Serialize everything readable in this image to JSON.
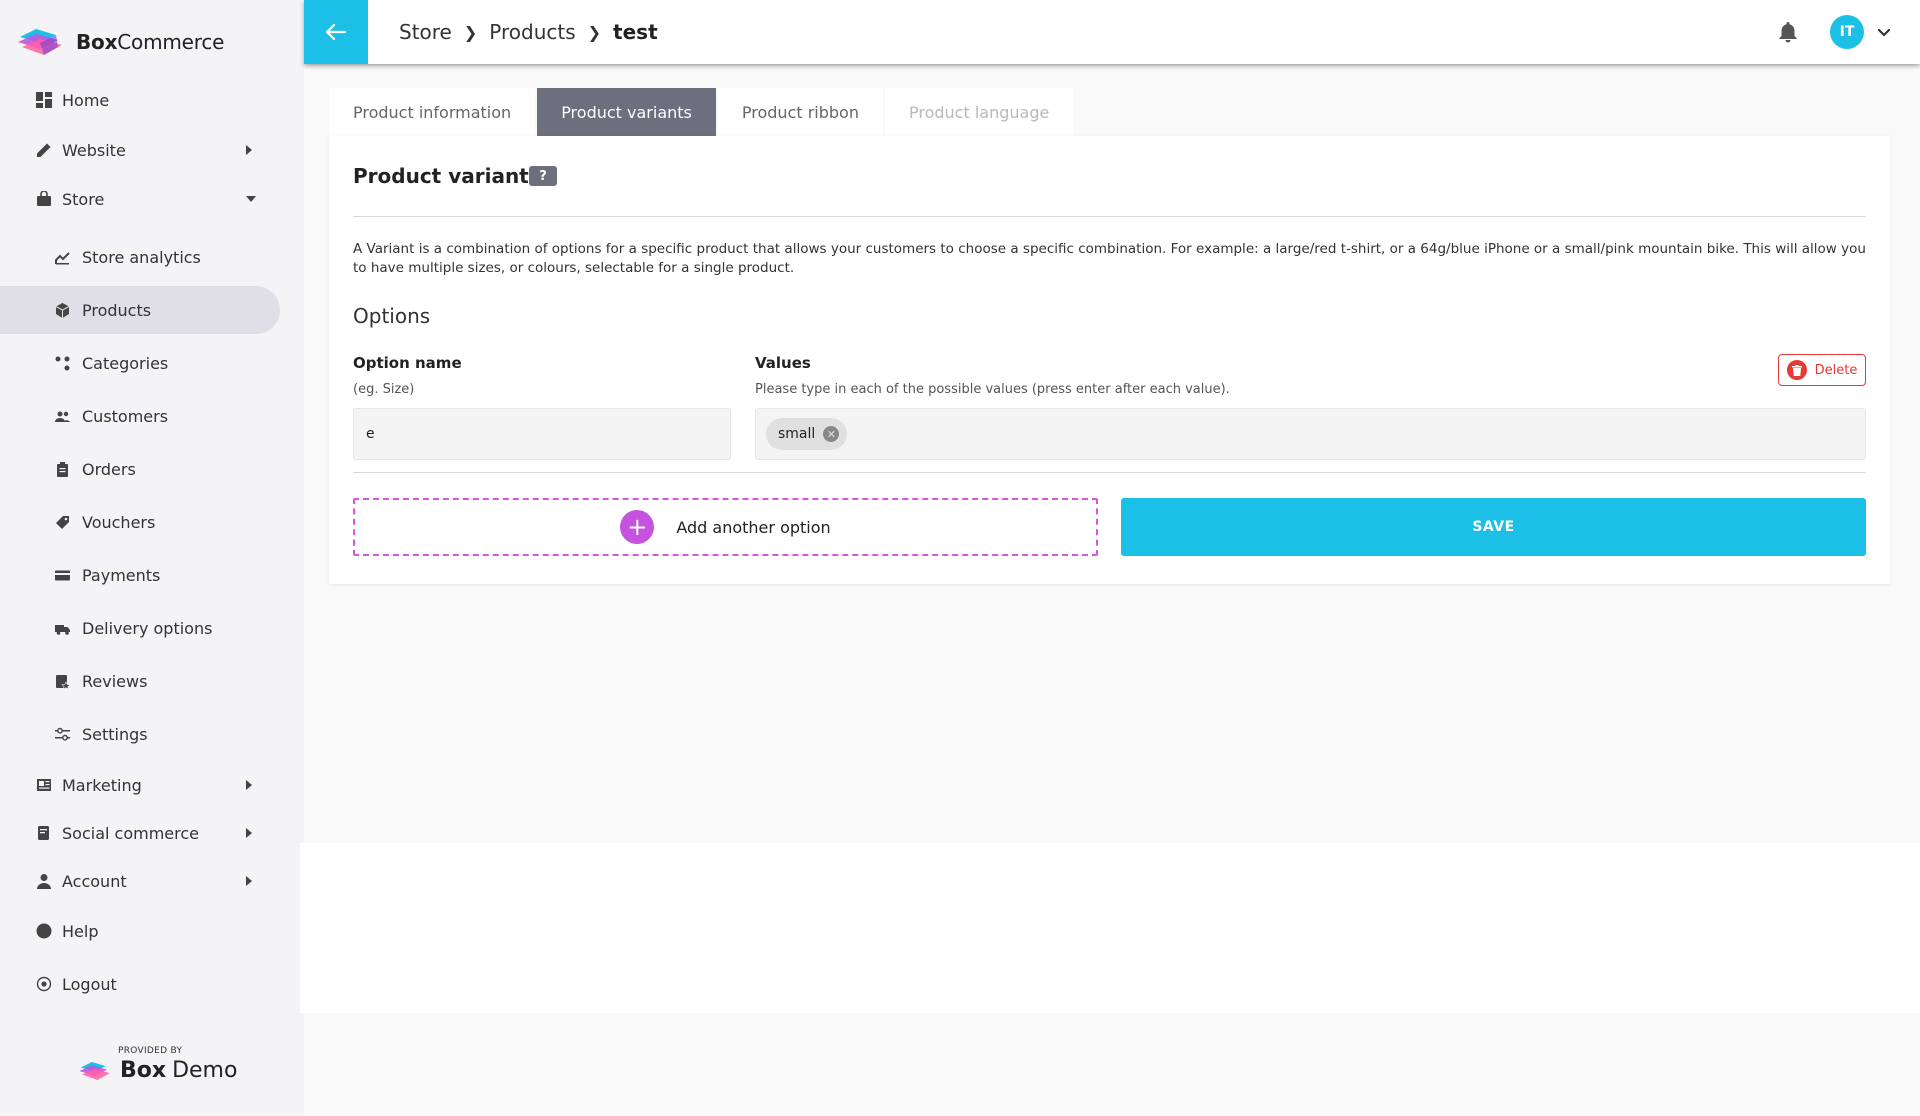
{
  "brand": {
    "name_bold": "Box",
    "name_rest": "Commerce"
  },
  "sidebar": {
    "items": [
      {
        "label": "Home",
        "icon": "dashboard-icon"
      },
      {
        "label": "Website",
        "icon": "pencil-icon"
      },
      {
        "label": "Store",
        "icon": "bag-icon"
      },
      {
        "label": "Marketing",
        "icon": "newspaper-icon"
      },
      {
        "label": "Social commerce",
        "icon": "share-icon"
      },
      {
        "label": "Account",
        "icon": "person-icon"
      },
      {
        "label": "Help",
        "icon": "help-circle-icon"
      },
      {
        "label": "Logout",
        "icon": "logout-icon"
      }
    ],
    "store_items": [
      {
        "label": "Store analytics",
        "icon": "chart-icon"
      },
      {
        "label": "Products",
        "icon": "box-icon"
      },
      {
        "label": "Categories",
        "icon": "categories-icon"
      },
      {
        "label": "Customers",
        "icon": "people-icon"
      },
      {
        "label": "Orders",
        "icon": "clipboard-icon"
      },
      {
        "label": "Vouchers",
        "icon": "voucher-icon"
      },
      {
        "label": "Payments",
        "icon": "card-icon"
      },
      {
        "label": "Delivery options",
        "icon": "truck-icon"
      },
      {
        "label": "Reviews",
        "icon": "reviews-icon"
      },
      {
        "label": "Settings",
        "icon": "sliders-icon"
      }
    ],
    "provided_by": "PROVIDED BY",
    "provider_bold": "Box",
    "provider_rest": "Demo"
  },
  "header": {
    "breadcrumb": [
      "Store",
      "Products",
      "test"
    ],
    "avatar_initials": "IT"
  },
  "tabs": [
    "Product information",
    "Product variants",
    "Product ribbon",
    "Product language"
  ],
  "variants": {
    "title": "Product variants",
    "help": "?",
    "description": "A Variant is a combination of options for a specific product that allows your customers to choose a specific combination. For example: a large/red t-shirt, or a 64g/blue iPhone or a small/pink mountain bike. This will allow you to have multiple sizes, or colours, selectable for a single product.",
    "options_title": "Options",
    "option_name_label": "Option name",
    "option_name_hint": "(eg. Size)",
    "option_name_value": "e",
    "values_label": "Values",
    "values_hint": "Please type in each of the possible values (press enter after each value).",
    "values": [
      "small"
    ],
    "delete_label": "Delete",
    "add_option_label": "Add another option",
    "save_label": "SAVE"
  },
  "colors": {
    "accent": "#1cbfe6",
    "tab_active": "#6c6f7d",
    "danger": "#e53935",
    "add_option": "#c553e0"
  }
}
